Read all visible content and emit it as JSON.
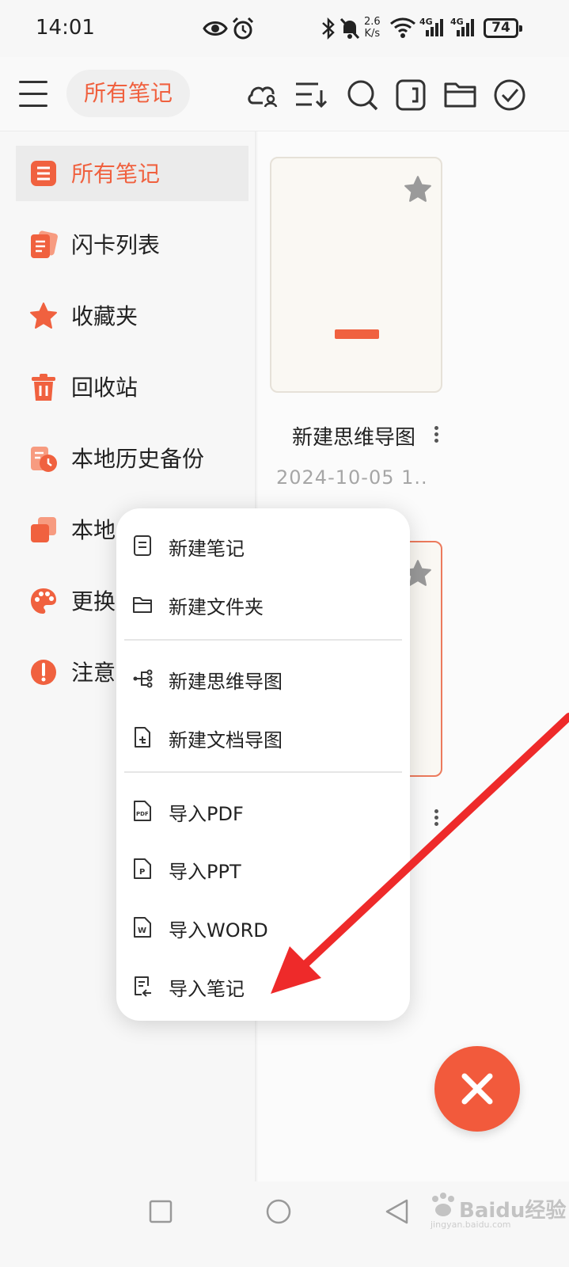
{
  "status_bar": {
    "time": "14:01",
    "network_speed_value": "2.6",
    "network_speed_unit": "K/s",
    "signal1_label": "4G",
    "signal2_label": "4G",
    "battery": "74"
  },
  "app_bar": {
    "title": "所有笔记",
    "icons": [
      "cloud-user-icon",
      "sort-icon",
      "search-icon",
      "tablet-icon",
      "folder-icon",
      "check-circle-icon"
    ]
  },
  "sidebar": {
    "items": [
      {
        "label": "所有笔记",
        "icon": "list-icon",
        "active": true
      },
      {
        "label": "闪卡列表",
        "icon": "flashcards-icon"
      },
      {
        "label": "收藏夹",
        "icon": "star-icon"
      },
      {
        "label": "回收站",
        "icon": "trash-icon"
      },
      {
        "label": "本地历史备份",
        "icon": "history-icon"
      },
      {
        "label": "本地",
        "icon": "copy-icon"
      },
      {
        "label": "更换",
        "icon": "palette-icon"
      },
      {
        "label": "注意",
        "icon": "alert-icon"
      }
    ]
  },
  "notes": [
    {
      "title": "新建思维导图",
      "date": "2024-10-05 1.."
    }
  ],
  "menu": {
    "items": [
      {
        "label": "新建笔记",
        "icon": "note-icon"
      },
      {
        "label": "新建文件夹",
        "icon": "folder-icon"
      },
      {
        "label": "新建思维导图",
        "icon": "mindmap-icon"
      },
      {
        "label": "新建文档导图",
        "icon": "doc-map-icon"
      },
      {
        "label": "导入PDF",
        "icon": "pdf-file-icon",
        "icon_text": "PDF"
      },
      {
        "label": "导入PPT",
        "icon": "ppt-file-icon",
        "icon_text": "P"
      },
      {
        "label": "导入WORD",
        "icon": "word-file-icon",
        "icon_text": "W"
      },
      {
        "label": "导入笔记",
        "icon": "import-note-icon"
      }
    ]
  },
  "fab": {
    "icon": "close-icon"
  },
  "watermark": {
    "text": "Baidu经验",
    "sub": "jingyan.baidu.com"
  },
  "colors": {
    "accent": "#f0613f",
    "fab": "#f25a3c",
    "arrow": "#ee2a2a"
  }
}
